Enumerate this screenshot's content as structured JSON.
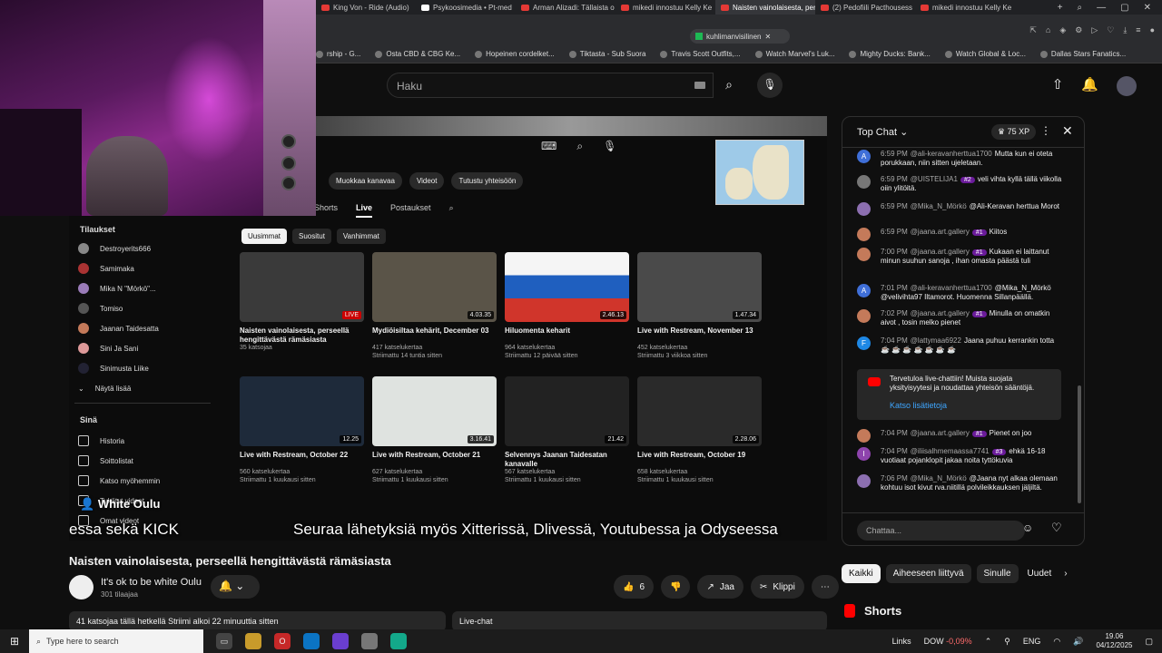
{
  "browser": {
    "tabs": [
      {
        "label": "King Von - Ride (Audio)",
        "active": false
      },
      {
        "label": "Psykoosimedia • Pt-med",
        "active": false
      },
      {
        "label": "Arman Alizadi: Tällaista o",
        "active": false
      },
      {
        "label": "mikedi innostuu Kelly Ke",
        "active": false
      },
      {
        "label": "Naisten vainolaisesta, per",
        "active": true
      },
      {
        "label": "(2) Pedofiili Pacthousess",
        "active": false
      },
      {
        "label": "mikedi innostuu Kelly Ke",
        "active": false
      }
    ],
    "omnibox": "kuhlimanvisilinen",
    "bookmarks": [
      "rship - G...",
      "Osta CBD & CBG Ke...",
      "Hopeinen cordelket...",
      "Tiktasta - Sub Suora",
      "Travis Scott Outfits,...",
      "Watch Marvel's Luk...",
      "Mighty Ducks: Bank...",
      "Watch Global & Loc...",
      "Dallas Stars Fanatics..."
    ]
  },
  "youtube": {
    "search_placeholder": "Haku"
  },
  "video": {
    "buttons": [
      "Muokkaa kanavaa",
      "Videot",
      "Tutustu yhteisöön"
    ],
    "nav": [
      "Shorts",
      "Live",
      "Postaukset"
    ],
    "chips": [
      "Uusimmat",
      "Suositut",
      "Vanhimmat"
    ],
    "sidebar": {
      "subs_title": "Tilaukset",
      "subs": [
        "Destroyerits666",
        "Samimaka",
        "Mika N \"Mörkö\"...",
        "Tomiso",
        "Jaanan Taidesatta",
        "Sini Ja Sani",
        "Sinimusta Liike"
      ],
      "show_more": "Näytä lisää",
      "you_title": "Sinä",
      "you_items": [
        "Historia",
        "Soittolistat",
        "Katso myöhemmin",
        "Tykätyt videot",
        "Omat videot"
      ]
    },
    "cards": [
      {
        "title": "Naisten vainolaisesta, perseellä hengittävästä rämäsiasta",
        "meta1": "35 katsojaa",
        "meta2": "",
        "dur": "LIVE",
        "color": "#3a3a3a"
      },
      {
        "title": "Mydiöisiltaa kehärit, December 03",
        "meta1": "417 katselukertaa",
        "meta2": "Striimattu 14 tuntia sitten",
        "dur": "4.03.35",
        "color": "#5a5448"
      },
      {
        "title": "Hiluomenta keharit",
        "meta1": "964 katselukertaa",
        "meta2": "Striimattu 12 päivää sitten",
        "dur": "2.46.13",
        "color": "#d0352b"
      },
      {
        "title": "Live with Restream, November 13",
        "meta1": "452 katselukertaa",
        "meta2": "Striimattu 3 viikkoa sitten",
        "dur": "1.47.34",
        "color": "#4a4a4a"
      },
      {
        "title": "Live with Restream, October 22",
        "meta1": "560 katselukertaa",
        "meta2": "Striimattu 1 kuukausi sitten",
        "dur": "12.25",
        "color": "#1e2a3a"
      },
      {
        "title": "Live with Restream, October 21",
        "meta1": "627 katselukertaa",
        "meta2": "Striimattu 1 kuukausi sitten",
        "dur": "3.16.41",
        "color": "#dfe3e0"
      },
      {
        "title": "Selvennys Jaanan Taidesatan kanavalle",
        "meta1": "567 katselukertaa",
        "meta2": "Striimattu 1 kuukausi sitten",
        "dur": "21.42",
        "color": "#222"
      },
      {
        "title": "Live with Restream, October 19",
        "meta1": "658 katselukertaa",
        "meta2": "Striimattu 1 kuukausi sitten",
        "dur": "2.28.06",
        "color": "#2a2a2a"
      }
    ],
    "overlay_left": "essa sekä KICK",
    "overlay_right": "Seuraa lähetyksiä myös Xitterissä, Dlivessä, Youtubessa ja Odyseessa",
    "overlay_channel": "White Oulu",
    "title": "Naisten vainolaisesta, perseellä hengittävästä rämäsiasta",
    "channel": "It's ok to be white Oulu",
    "subs": "301 tilaajaa",
    "likes": "6",
    "share": "Jaa",
    "clip": "Klippi",
    "info": "41 katsojaa tällä hetkellä  Striimi alkoi 22 minuuttia sitten",
    "livechat_label": "Live-chat"
  },
  "chat": {
    "title": "Top Chat",
    "xp": "75 XP",
    "messages": [
      {
        "time": "6:59 PM",
        "author": "@ali-keravanherttua1700",
        "badge": "",
        "text": "Mutta kun ei oteta porukkaan, niin sitten ujeletaan.",
        "av": "A",
        "avc": "#3f6fd8"
      },
      {
        "time": "6:59 PM",
        "author": "@UISTELIJA1",
        "badge": "#2",
        "text": "veli vihta kyllä tällä viikolla oiin ylitöitä.",
        "av": "",
        "avc": "#777"
      },
      {
        "time": "6:59 PM",
        "author": "@Mika_N_Mörkö",
        "badge": "",
        "text": "@Ali-Keravan herttua Morot",
        "av": "",
        "avc": "#8c6fb0"
      },
      {
        "time": "6:59 PM",
        "author": "@jaana.art.gallery",
        "badge": "#1",
        "text": "Kiitos",
        "av": "",
        "avc": "#c47a5a"
      },
      {
        "time": "7:00 PM",
        "author": "@jaana.art.gallery",
        "badge": "#1",
        "text": "Kukaan ei laittanut minun suuhun sanoja , ihan omasta päästä tuli",
        "av": "",
        "avc": "#c47a5a"
      },
      {
        "time": "7:01 PM",
        "author": "@ali-keravanherttua1700",
        "badge": "",
        "text": "@Mika_N_Mörkö @velivihta97 Iltamorot. Huomenna Sillanpäällä.",
        "av": "A",
        "avc": "#3f6fd8"
      },
      {
        "time": "7:02 PM",
        "author": "@jaana.art.gallery",
        "badge": "#1",
        "text": "Minulla on omatkin aivot , tosin melko pienet",
        "av": "",
        "avc": "#c47a5a"
      },
      {
        "time": "7:04 PM",
        "author": "@lattymaa6922",
        "badge": "",
        "text": "Jaana puhuu kerrankin totta ☕ ☕ ☕ ☕ ☕ ☕ ☕",
        "av": "F",
        "avc": "#1e88e5"
      },
      {
        "time": "7:04 PM",
        "author": "@jaana.art.gallery",
        "badge": "#1",
        "text": "Pienet on joo",
        "av": "",
        "avc": "#c47a5a"
      },
      {
        "time": "7:04 PM",
        "author": "@iliisalhmemaassa7741",
        "badge": "#3",
        "text": "ehkä 16-18 vuotiaat pojanklopit jakaa noita tyttökuvia",
        "av": "I",
        "avc": "#8e44ad"
      },
      {
        "time": "7:06 PM",
        "author": "@Mika_N_Mörkö",
        "badge": "",
        "text": "@Jaana nyt alkaa olemaan kohtuu isot kivut rva.niitillä polvileikkauksen jäljiltä.",
        "av": "",
        "avc": "#8c6fb0"
      }
    ],
    "welcome": "Tervetuloa live-chattiin! Muista suojata yksityisyytesi ja noudattaa yhteisön sääntöjä.",
    "welcome_link": "Katso lisätietoja",
    "input_placeholder": "Chattaa..."
  },
  "filters": [
    "Kaikki",
    "Aiheeseen liittyvä",
    "Sinulle",
    "Uudet"
  ],
  "shorts": "Shorts",
  "taskbar": {
    "search": "Type here to search",
    "links": "Links",
    "ticker": "DOW",
    "change": "-0,09%",
    "lang": "ENG",
    "time": "19.06",
    "date": "04/12/2025"
  }
}
